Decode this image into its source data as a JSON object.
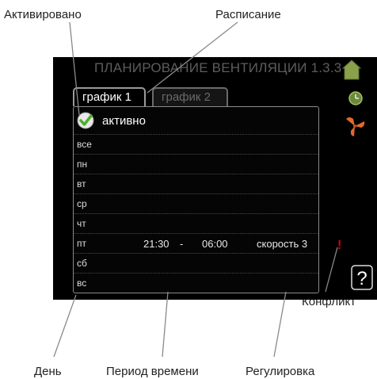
{
  "callouts": {
    "activated": "Активировано",
    "schedule": "Расписание",
    "conflict": "Конфликт",
    "day": "День",
    "time_period": "Период времени",
    "adjustment": "Регулировка"
  },
  "screen": {
    "title": "ПЛАНИРОВАНИЕ ВЕНТИЛЯЦИИ 1.3.3",
    "tabs": [
      {
        "label": "график 1",
        "selected": true
      },
      {
        "label": "график 2",
        "selected": false
      }
    ],
    "active_label": "активно",
    "active_checked": true,
    "days": [
      {
        "name": "все",
        "start": "",
        "sep": "",
        "end": "",
        "setting": "",
        "conflict": false
      },
      {
        "name": "пн",
        "start": "",
        "sep": "",
        "end": "",
        "setting": "",
        "conflict": false
      },
      {
        "name": "вт",
        "start": "",
        "sep": "",
        "end": "",
        "setting": "",
        "conflict": false
      },
      {
        "name": "ср",
        "start": "",
        "sep": "",
        "end": "",
        "setting": "",
        "conflict": false
      },
      {
        "name": "чт",
        "start": "",
        "sep": "",
        "end": "",
        "setting": "",
        "conflict": false
      },
      {
        "name": "пт",
        "start": "21:30",
        "sep": "-",
        "end": "06:00",
        "setting": "скорость 3",
        "conflict": true
      },
      {
        "name": "сб",
        "start": "",
        "sep": "",
        "end": "",
        "setting": "",
        "conflict": false
      },
      {
        "name": "вс",
        "start": "",
        "sep": "",
        "end": "",
        "setting": "",
        "conflict": false
      }
    ],
    "conflict_mark": "!",
    "help_label": "?"
  },
  "colors": {
    "check_green": "#4caf2a",
    "fan_orange": "#e06a2a",
    "conflict_red": "#e00000"
  }
}
